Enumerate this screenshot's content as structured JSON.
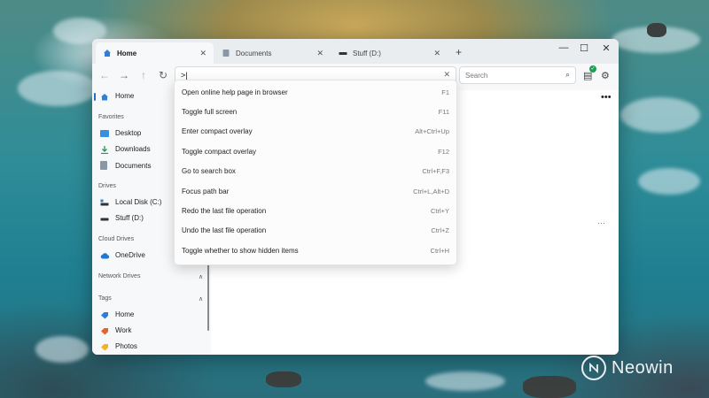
{
  "tabs": [
    {
      "label": "Home",
      "icon": "home-icon",
      "active": true
    },
    {
      "label": "Documents",
      "icon": "document-icon",
      "active": false
    },
    {
      "label": "Stuff (D:)",
      "icon": "drive-icon",
      "active": false
    }
  ],
  "tab_close_glyph": "✕",
  "new_tab_glyph": "+",
  "window_controls": {
    "minimize": "—",
    "maximize": "☐",
    "close": "✕"
  },
  "nav": {
    "back": "←",
    "forward": "→",
    "up": "↑",
    "refresh": "↻"
  },
  "path_bar": {
    "value": ">|",
    "clear_glyph": "✕"
  },
  "search": {
    "placeholder": "Search",
    "icon_glyph": "⌕"
  },
  "toolbar_icons": {
    "clipboard": "▤",
    "settings": "⚙",
    "badge": "✓"
  },
  "sidebar": {
    "home": "Home",
    "sections": {
      "favorites": "Favorites",
      "drives": "Drives",
      "cloud_drives": "Cloud Drives",
      "network_drives": "Network Drives",
      "tags": "Tags"
    },
    "favorites": [
      "Desktop",
      "Downloads",
      "Documents"
    ],
    "drives": [
      "Local Disk (C:)",
      "Stuff (D:)"
    ],
    "cloud": [
      "OneDrive"
    ],
    "tags": [
      "Home",
      "Work",
      "Photos"
    ],
    "chevron_glyph": "∧"
  },
  "main": {
    "more_glyph": "•••",
    "more_small_glyph": "···"
  },
  "commands": [
    {
      "label": "Open online help page in browser",
      "hotkey": "F1"
    },
    {
      "label": "Toggle full screen",
      "hotkey": "F11"
    },
    {
      "label": "Enter compact overlay",
      "hotkey": "Alt+Ctrl+Up"
    },
    {
      "label": "Toggle compact overlay",
      "hotkey": "F12"
    },
    {
      "label": "Go to search box",
      "hotkey": "Ctrl+F,F3"
    },
    {
      "label": "Focus path bar",
      "hotkey": "Ctrl+L,Alt+D"
    },
    {
      "label": "Redo the last file operation",
      "hotkey": "Ctrl+Y"
    },
    {
      "label": "Undo the last file operation",
      "hotkey": "Ctrl+Z"
    },
    {
      "label": "Toggle whether to show hidden items",
      "hotkey": "Ctrl+H"
    }
  ],
  "colors": {
    "accent": "#1f6fc4",
    "tag_home": "#2f7fd8",
    "tag_work": "#e0662e",
    "tag_photos": "#f0b429",
    "onedrive": "#1e78d6"
  },
  "watermark": {
    "text": "Neowin"
  }
}
